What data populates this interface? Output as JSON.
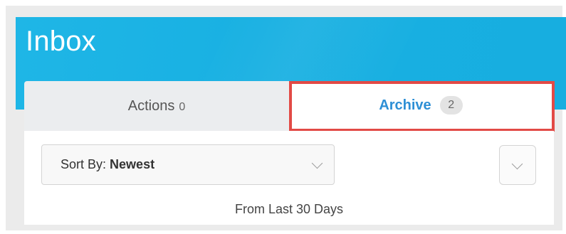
{
  "header": {
    "title": "Inbox"
  },
  "tabs": {
    "actions": {
      "label": "Actions",
      "count": "0"
    },
    "archive": {
      "label": "Archive",
      "count": "2",
      "selected": true
    }
  },
  "sort": {
    "prefix": "Sort By:",
    "value": "Newest"
  },
  "filter": {
    "range_text": "From Last 30 Days"
  },
  "icons": {
    "sort_dropdown": "chevron-down-icon",
    "expand_button": "chevron-down-icon"
  },
  "colors": {
    "header_bg": "#1fb6e6",
    "archive_tab_text": "#2d8fd5",
    "highlight_border": "#e24a46"
  }
}
